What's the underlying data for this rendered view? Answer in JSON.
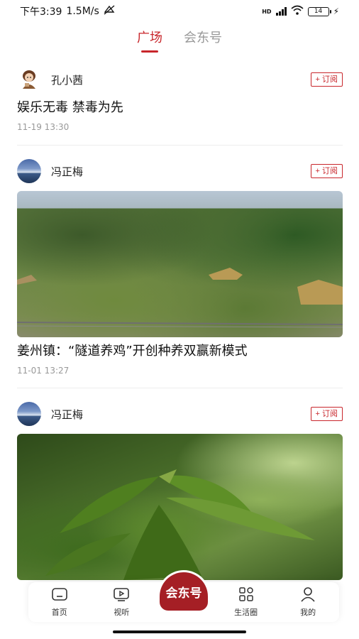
{
  "status_bar": {
    "time": "下午3:39",
    "speed": "1.5M/s",
    "network": "HD",
    "battery": "14"
  },
  "top_tabs": [
    {
      "label": "广场",
      "active": true
    },
    {
      "label": "会东号",
      "active": false
    }
  ],
  "posts": [
    {
      "author": "孔小茜",
      "subscribe_label": "+ 订阅",
      "title": "娱乐无毒 禁毒为先",
      "time": "11-19 13:30"
    },
    {
      "author": "冯正梅",
      "subscribe_label": "+ 订阅",
      "title": "姜州镇：“隧道养鸡”开创种养双赢新模式",
      "time": "11-01 13:27"
    },
    {
      "author": "冯正梅",
      "subscribe_label": "+ 订阅"
    }
  ],
  "bottom_nav": {
    "items": [
      {
        "label": "首页",
        "icon": "home-icon"
      },
      {
        "label": "视听",
        "icon": "tv-icon"
      },
      {
        "label": "会东号",
        "icon": "logo"
      },
      {
        "label": "生活圈",
        "icon": "grid-icon"
      },
      {
        "label": "我的",
        "icon": "user-icon"
      }
    ]
  },
  "colors": {
    "accent": "#c8262b",
    "logo": "#a51f25"
  }
}
